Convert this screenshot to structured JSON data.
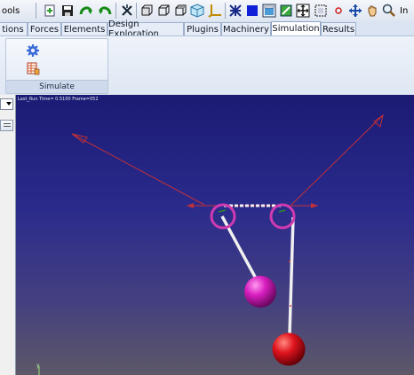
{
  "toolbar": {
    "menu_label": "ools",
    "trailing_label": "In",
    "icons": [
      "new-icon",
      "save-icon",
      "redo-icon",
      "undo-icon",
      "close-x-icon",
      "view-front-icon",
      "view-side-icon",
      "view-top-icon",
      "view-iso-icon",
      "axes-icon",
      "grid-icon",
      "shaded-icon",
      "wireframe-icon",
      "select-icon",
      "fit-icon",
      "zoom-window-icon",
      "dot-icon",
      "translate-icon",
      "pan-icon",
      "zoom-icon"
    ]
  },
  "tabs": [
    {
      "label": "tions"
    },
    {
      "label": "Forces"
    },
    {
      "label": "Elements"
    },
    {
      "label": "Design Exploration"
    },
    {
      "label": "Plugins"
    },
    {
      "label": "Machinery"
    },
    {
      "label": "Simulation",
      "active": true
    },
    {
      "label": "Results"
    }
  ],
  "ribbon": {
    "group_label": "Simulate",
    "icons": [
      "gear-icon",
      "table-icon"
    ]
  },
  "viewport": {
    "status": "Last_Run   Time=  0.5100  Frame=052",
    "axis_label": "y",
    "colors": {
      "force_arrow": "#c0303a",
      "joint_marker": "#d03ab0",
      "link": "#f0f0f0",
      "ball_magenta": "#d81ec0",
      "ball_red": "#e0141e"
    }
  }
}
